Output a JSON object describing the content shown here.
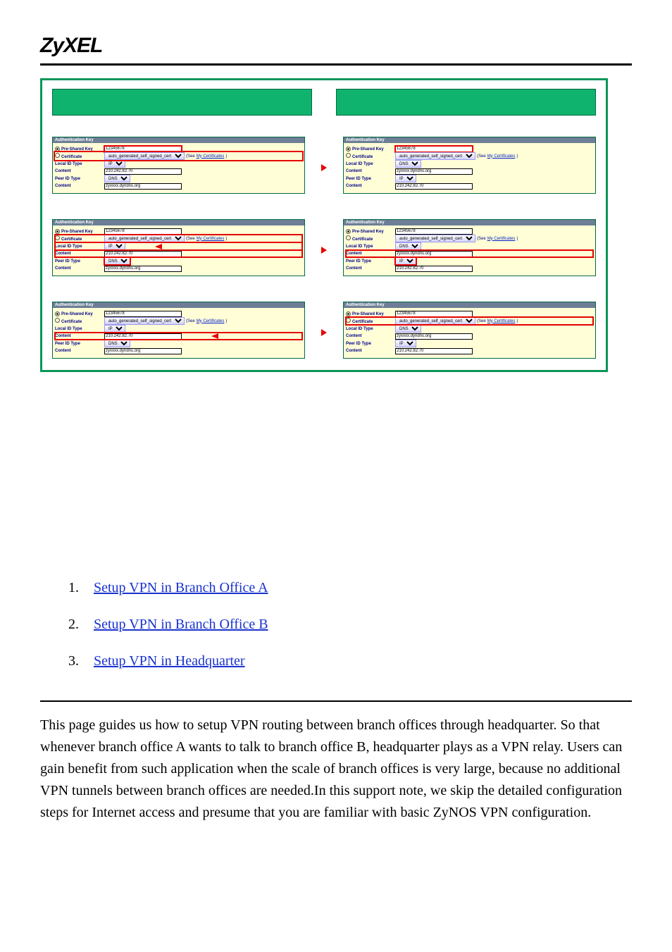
{
  "brand": "ZyXEL",
  "panel": {
    "header": "Authentication Key",
    "pre_shared_label": "Pre-Shared Key",
    "certificate_label": "Certificate",
    "see_label": "(See ",
    "see_link": "My Certificates",
    "see_tail": ")",
    "local_id_type_label": "Local ID Type",
    "peer_id_type_label": "Peer ID Type",
    "content_label": "Content",
    "psk_value": "12345678",
    "cert_value": "auto_generated_self_signed_cert",
    "opt_ip": "IP",
    "opt_dns": "DNS",
    "ip_left": "210.242.82.70",
    "dns_host": "zyxxxx.dyndns.org"
  },
  "links": {
    "n1": "1.",
    "n2": "2.",
    "n3": "3.",
    "l1": "Setup VPN in Branch Office A",
    "l2": "Setup VPN in Branch Office B",
    "l3": "Setup VPN in Headquarter"
  },
  "paragraph": "This page guides us how to setup VPN routing between branch offices through headquarter. So that whenever branch office A wants to talk to branch office B, headquarter plays as a VPN relay. Users can gain benefit from  such application when the scale of branch offices is very large, because no additional VPN tunnels between branch offices are needed.In this support note, we skip the detailed configuration steps for Internet access and presume that you are familiar with basic ZyNOS VPN configuration."
}
